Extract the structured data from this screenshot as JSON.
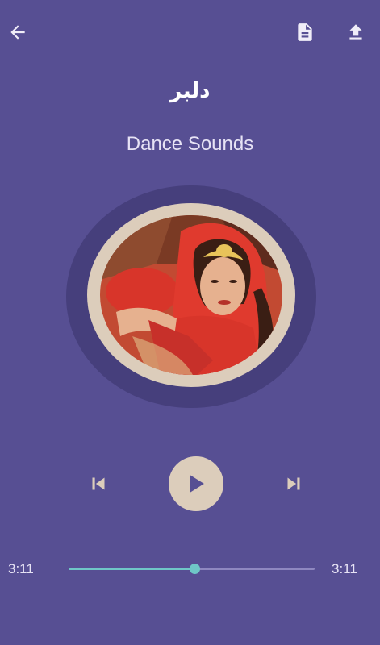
{
  "colors": {
    "background": "#574F93",
    "disc_outer": "#463F7C",
    "disc_ring": "#DCCDBB",
    "accent": "#6FC7C7",
    "control_tint": "#DCCDBB"
  },
  "header": {
    "back_icon": "arrow-left-icon",
    "document_icon": "document-icon",
    "upload_icon": "upload-icon"
  },
  "track": {
    "title": "دلبر",
    "subtitle": "Dance Sounds",
    "artwork": "dancer-in-red-dress-photo"
  },
  "controls": {
    "previous_icon": "skip-previous-icon",
    "play_icon": "play-icon",
    "next_icon": "skip-next-icon"
  },
  "progress": {
    "elapsed": "3:11",
    "total": "3:11",
    "position_fraction": 0.51
  }
}
